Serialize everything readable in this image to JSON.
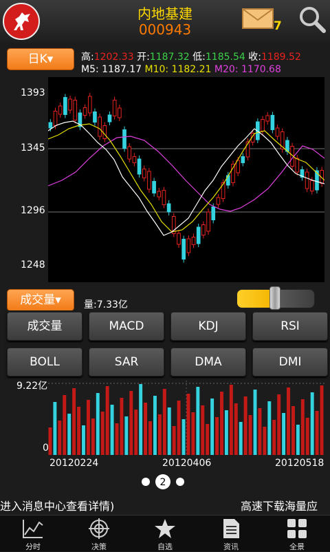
{
  "header": {
    "stock_name": "内地基建",
    "stock_code": "000943",
    "message_count": "7",
    "icons": [
      "logo-horse-icon",
      "mail-icon",
      "search-icon"
    ]
  },
  "period_button": "日K▾",
  "quote": {
    "high_label": "高:",
    "high": "1202.33",
    "open_label": "开:",
    "open": "1187.32",
    "low_label": "低:",
    "low": "1185.54",
    "close_label": "收:",
    "close": "1189.52",
    "m5": "M5: 1187.17",
    "m10": "M10: 1182.21",
    "m20": "M20: 1170.68"
  },
  "colors": {
    "up": "#e8231f",
    "down": "#35d2e0",
    "ma5": "#ffffff",
    "ma10": "#e8e000",
    "ma20": "#e040e0",
    "accent": "#f27b18"
  },
  "y_ticks": [
    "1393",
    "1345",
    "1296",
    "1248"
  ],
  "volume": {
    "button": "成交量▾",
    "label": "量:7.33亿",
    "max_label": "9.22亿",
    "zero_label": "0",
    "dates": [
      "20120224",
      "20120406",
      "20120518"
    ]
  },
  "indicators": [
    "成交量",
    "MACD",
    "KDJ",
    "RSI",
    "BOLL",
    "SAR",
    "DMA",
    "DMI"
  ],
  "pager": {
    "current": "2"
  },
  "marquee": {
    "left": "进入消息中心查看详情)",
    "right": "高速下载海量应"
  },
  "tabs": [
    {
      "label": "分时",
      "icon": "line-chart-icon"
    },
    {
      "label": "决策",
      "icon": "target-icon"
    },
    {
      "label": "自选",
      "icon": "star-icon"
    },
    {
      "label": "资讯",
      "icon": "document-icon"
    },
    {
      "label": "全景",
      "icon": "grid-icon"
    }
  ]
}
